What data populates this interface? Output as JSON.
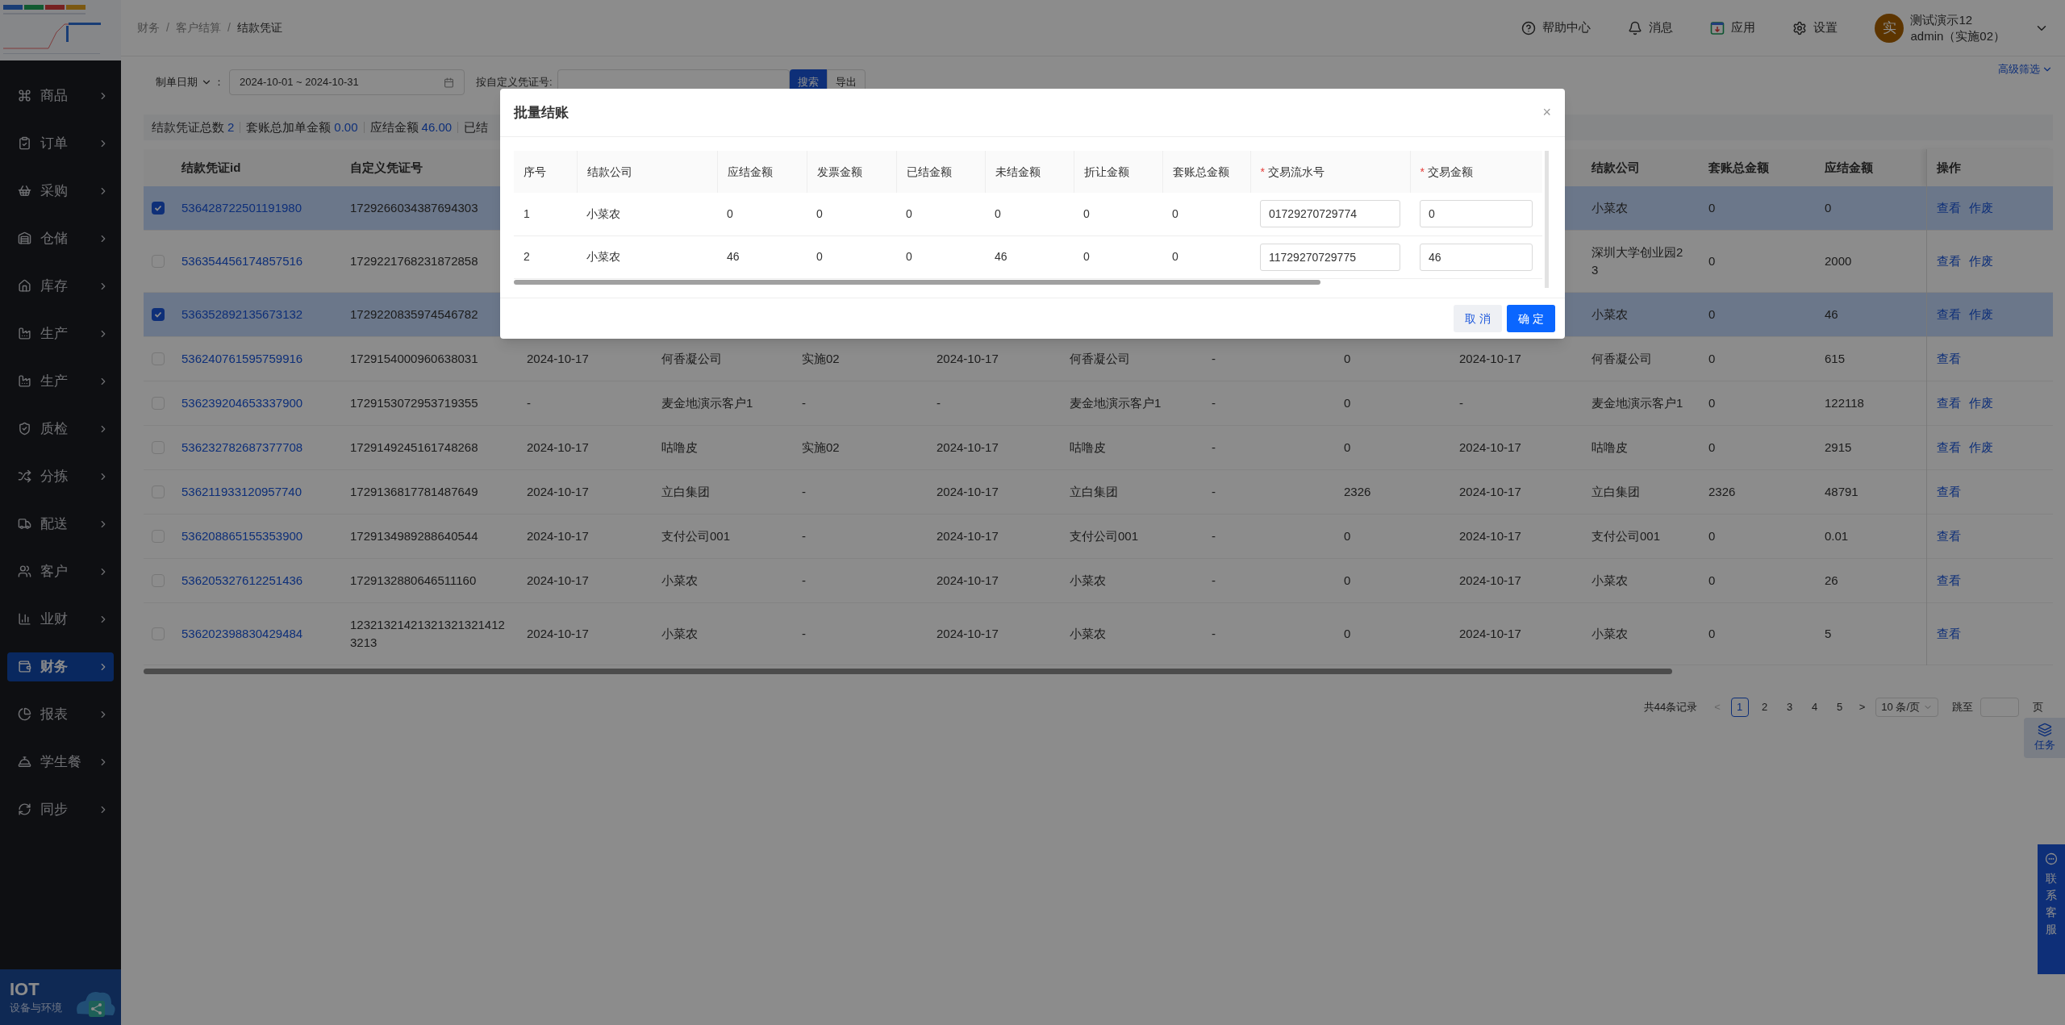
{
  "sidebar": {
    "items": [
      {
        "label": "商品",
        "selected": false
      },
      {
        "label": "订单",
        "selected": false
      },
      {
        "label": "采购",
        "selected": false
      },
      {
        "label": "仓储",
        "selected": false
      },
      {
        "label": "库存",
        "selected": false
      },
      {
        "label": "生产",
        "selected": false
      },
      {
        "label": "生产",
        "selected": false
      },
      {
        "label": "质检",
        "selected": false
      },
      {
        "label": "分拣",
        "selected": false
      },
      {
        "label": "配送",
        "selected": false
      },
      {
        "label": "客户",
        "selected": false
      },
      {
        "label": "业财",
        "selected": false
      },
      {
        "label": "财务",
        "selected": true
      },
      {
        "label": "报表",
        "selected": false
      },
      {
        "label": "学生餐",
        "selected": false
      },
      {
        "label": "同步",
        "selected": false
      }
    ],
    "banner": {
      "title": "IOT",
      "subtitle": "设备与环境"
    }
  },
  "header": {
    "breadcrumb": [
      "财务",
      "客户结算",
      "结款凭证"
    ],
    "separator": "/",
    "actions": [
      {
        "kind": "help",
        "label": "帮助中心"
      },
      {
        "kind": "bell",
        "label": "消息"
      },
      {
        "kind": "app",
        "label": "应用"
      },
      {
        "kind": "gear",
        "label": "设置"
      }
    ],
    "user": {
      "avatar": "实",
      "name": "测试演示12",
      "role": "admin（实施02）"
    }
  },
  "filters": {
    "date_type": "制单日期",
    "colon": "：",
    "date_range": "2024-10-01 ~ 2024-10-31",
    "voucher_label": "按自定义凭证号:",
    "search": "搜索",
    "export": "导出",
    "advanced": "高级筛选"
  },
  "summary": [
    {
      "label": "结款凭证总数",
      "value": "2"
    },
    {
      "label": "套账总加单金额",
      "value": "0.00"
    },
    {
      "label": "应结金额",
      "value": "46.00"
    },
    {
      "label": "已结"
    }
  ],
  "table": {
    "columns": [
      "结款凭证id",
      "自定义凭证号",
      null,
      null,
      null,
      null,
      null,
      null,
      null,
      null,
      "结款公司",
      "套账总金额",
      "应结金额",
      "操作"
    ],
    "rows": [
      {
        "selected": true,
        "cells": [
          "536428722501191980",
          "1729266034387694303",
          null,
          null,
          null,
          null,
          null,
          null,
          null,
          null,
          "小菜农",
          "0",
          "0"
        ],
        "actions": [
          "查看",
          "作废"
        ]
      },
      {
        "selected": false,
        "cells": [
          "536354456174857516",
          "1729221768231872858",
          null,
          null,
          null,
          null,
          null,
          null,
          null,
          null,
          "深圳大学创业园23",
          "0",
          "2000"
        ],
        "actions": [
          "查看",
          "作废"
        ]
      },
      {
        "selected": true,
        "cells": [
          "536352892135673132",
          "1729220835974546782",
          null,
          null,
          null,
          null,
          null,
          null,
          null,
          null,
          "小菜农",
          "0",
          "46"
        ],
        "actions": [
          "查看",
          "作废"
        ]
      },
      {
        "selected": false,
        "cells": [
          "536240761595759916",
          "1729154000960638031",
          "2024-10-17",
          "何香凝公司",
          "实施02",
          "2024-10-17",
          "何香凝公司",
          "-",
          "0",
          "2024-10-17",
          "何香凝公司",
          "0",
          "615"
        ],
        "actions": [
          "查看"
        ]
      },
      {
        "selected": false,
        "cells": [
          "536239204653337900",
          "1729153072953719355",
          "-",
          "麦金地演示客户1",
          "-",
          "-",
          "麦金地演示客户1",
          "-",
          "0",
          "-",
          "麦金地演示客户1",
          "0",
          "122118"
        ],
        "actions": [
          "查看",
          "作废"
        ]
      },
      {
        "selected": false,
        "cells": [
          "536232782687377708",
          "1729149245161748268",
          "2024-10-17",
          "咕噜皮",
          "实施02",
          "2024-10-17",
          "咕噜皮",
          "-",
          "0",
          "2024-10-17",
          "咕噜皮",
          "0",
          "2915"
        ],
        "actions": [
          "查看",
          "作废"
        ]
      },
      {
        "selected": false,
        "cells": [
          "536211933120957740",
          "1729136817781487649",
          "2024-10-17",
          "立白集团",
          "-",
          "2024-10-17",
          "立白集团",
          "-",
          "2326",
          "2024-10-17",
          "立白集团",
          "2326",
          "48791"
        ],
        "actions": [
          "查看"
        ]
      },
      {
        "selected": false,
        "cells": [
          "536208865155353900",
          "1729134989288640544",
          "2024-10-17",
          "支付公司001",
          "-",
          "2024-10-17",
          "支付公司001",
          "-",
          "0",
          "2024-10-17",
          "支付公司001",
          "0",
          "0.01"
        ],
        "actions": [
          "查看"
        ]
      },
      {
        "selected": false,
        "cells": [
          "536205327612251436",
          "1729132880646511160",
          "2024-10-17",
          "小菜农",
          "-",
          "2024-10-17",
          "小菜农",
          "-",
          "0",
          "2024-10-17",
          "小菜农",
          "0",
          "26"
        ],
        "actions": [
          "查看"
        ]
      },
      {
        "selected": false,
        "cells": [
          "536202398830429484",
          "123213214213213213214123213",
          "2024-10-17",
          "小菜农",
          "-",
          "2024-10-17",
          "小菜农",
          "-",
          "0",
          "2024-10-17",
          "小菜农",
          "0",
          "5"
        ],
        "actions": [
          "查看"
        ]
      }
    ]
  },
  "pagination": {
    "total": "共44条记录",
    "prev": "<",
    "pages": [
      {
        "label": "1",
        "selected": true
      },
      {
        "label": "2",
        "selected": false
      },
      {
        "label": "3",
        "selected": false
      },
      {
        "label": "4",
        "selected": false
      },
      {
        "label": "5",
        "selected": false
      }
    ],
    "next": ">",
    "page_size": "10 条/页",
    "jump_label": "跳至",
    "jump_suffix": "页"
  },
  "float_buttons": {
    "task": "任务",
    "support": "联系客服"
  },
  "dialog": {
    "title": "批量结账",
    "close": "×",
    "columns": [
      {
        "label": "序号"
      },
      {
        "label": "结款公司"
      },
      {
        "label": "应结金额"
      },
      {
        "label": "发票金额"
      },
      {
        "label": "已结金额"
      },
      {
        "label": "未结金额"
      },
      {
        "label": "折让金额"
      },
      {
        "label": "套账总金额"
      },
      {
        "label": "交易流水号",
        "required_mark": "*"
      },
      {
        "label": "交易金额",
        "required_mark": "*"
      }
    ],
    "rows": [
      {
        "cells": [
          "1",
          "小菜农",
          "0",
          "0",
          "0",
          "0",
          "0",
          "0"
        ],
        "serial": "01729270729774",
        "amount": "0"
      },
      {
        "cells": [
          "2",
          "小菜农",
          "46",
          "0",
          "0",
          "46",
          "0",
          "0"
        ],
        "serial": "11729270729775",
        "amount": "46"
      }
    ],
    "cancel": "取 消",
    "confirm": "确 定"
  }
}
